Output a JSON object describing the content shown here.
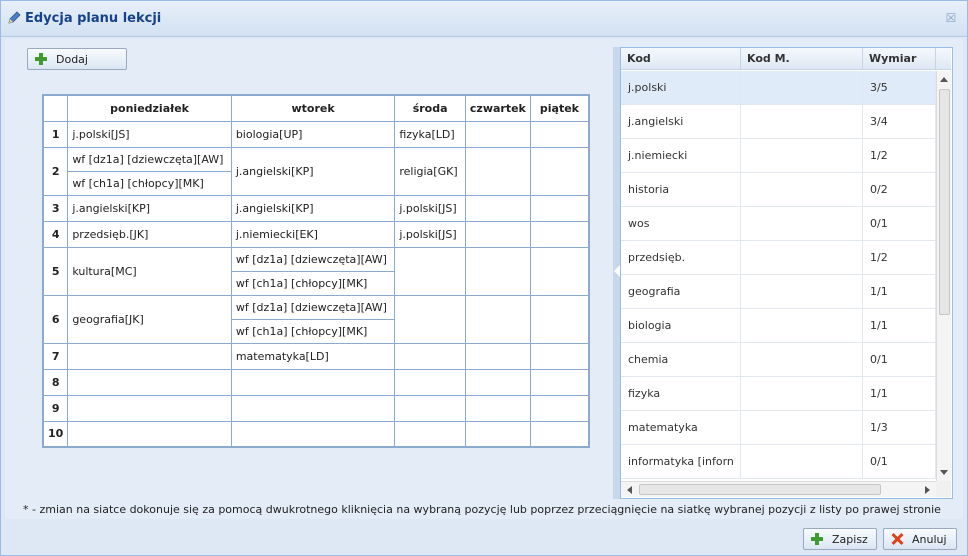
{
  "window": {
    "title": "Edycja planu lekcji",
    "close_glyph": "☒"
  },
  "toolbar": {
    "add_label": "Dodaj"
  },
  "schedule": {
    "headers": [
      "poniedziałek",
      "wtorek",
      "środa",
      "czwartek",
      "piątek"
    ],
    "r1": {
      "num": "1",
      "mon": "j.polski[JS]",
      "tue": "biologia[UP]",
      "wed": "fizyka[LD]"
    },
    "r2": {
      "num": "2",
      "mon_a": "wf [dz1a] [dziewczęta][AW]",
      "mon_b": "wf [ch1a] [chłopcy][MK]",
      "tue": "j.angielski[KP]",
      "wed": "religia[GK]"
    },
    "r3": {
      "num": "3",
      "mon": "j.angielski[KP]",
      "tue": "j.angielski[KP]",
      "wed": "j.polski[JS]"
    },
    "r4": {
      "num": "4",
      "mon": "przedsięb.[JK]",
      "tue": "j.niemiecki[EK]",
      "wed": "j.polski[JS]"
    },
    "r5": {
      "num": "5",
      "mon": "kultura[MC]",
      "tue_a": "wf [dz1a] [dziewczęta][AW]",
      "tue_b": "wf [ch1a] [chłopcy][MK]"
    },
    "r6": {
      "num": "6",
      "mon": "geografia[JK]",
      "tue_a": "wf [dz1a] [dziewczęta][AW]",
      "tue_b": "wf [ch1a] [chłopcy][MK]"
    },
    "r7": {
      "num": "7",
      "tue": "matematyka[LD]"
    },
    "r8": {
      "num": "8"
    },
    "r9": {
      "num": "9"
    },
    "r10": {
      "num": "10"
    }
  },
  "subjects": {
    "columns": {
      "code": "Kod",
      "code_m": "Kod M.",
      "dimension": "Wymiar"
    },
    "rows": [
      {
        "code": "j.polski",
        "code_m": "",
        "dimension": "3/5"
      },
      {
        "code": "j.angielski",
        "code_m": "",
        "dimension": "3/4"
      },
      {
        "code": "j.niemiecki",
        "code_m": "",
        "dimension": "1/2"
      },
      {
        "code": "historia",
        "code_m": "",
        "dimension": "0/2"
      },
      {
        "code": "wos",
        "code_m": "",
        "dimension": "0/1"
      },
      {
        "code": "przedsięb.",
        "code_m": "",
        "dimension": "1/2"
      },
      {
        "code": "geografia",
        "code_m": "",
        "dimension": "1/1"
      },
      {
        "code": "biologia",
        "code_m": "",
        "dimension": "1/1"
      },
      {
        "code": "chemia",
        "code_m": "",
        "dimension": "0/1"
      },
      {
        "code": "fizyka",
        "code_m": "",
        "dimension": "1/1"
      },
      {
        "code": "matematyka",
        "code_m": "",
        "dimension": "1/3"
      },
      {
        "code": "informatyka [inforn",
        "code_m": "",
        "dimension": "0/1"
      }
    ]
  },
  "footnote": "* - zmian na siatce dokonuje się za pomocą dwukrotnego kliknięcia na wybraną pozycję lub poprzez przeciągnięcie na siatkę wybranej pozycji z listy po prawej stronie",
  "footer": {
    "save_label": "Zapisz",
    "cancel_label": "Anuluj"
  },
  "icons": {
    "title": "pencil-icon",
    "add": "plus-icon",
    "save": "plus-icon",
    "cancel": "x-icon"
  },
  "colors": {
    "title_text": "#15428b",
    "plus": "#3d9c2d",
    "cancel_x": "#d9441c",
    "selected_row": "#dfebf8"
  }
}
